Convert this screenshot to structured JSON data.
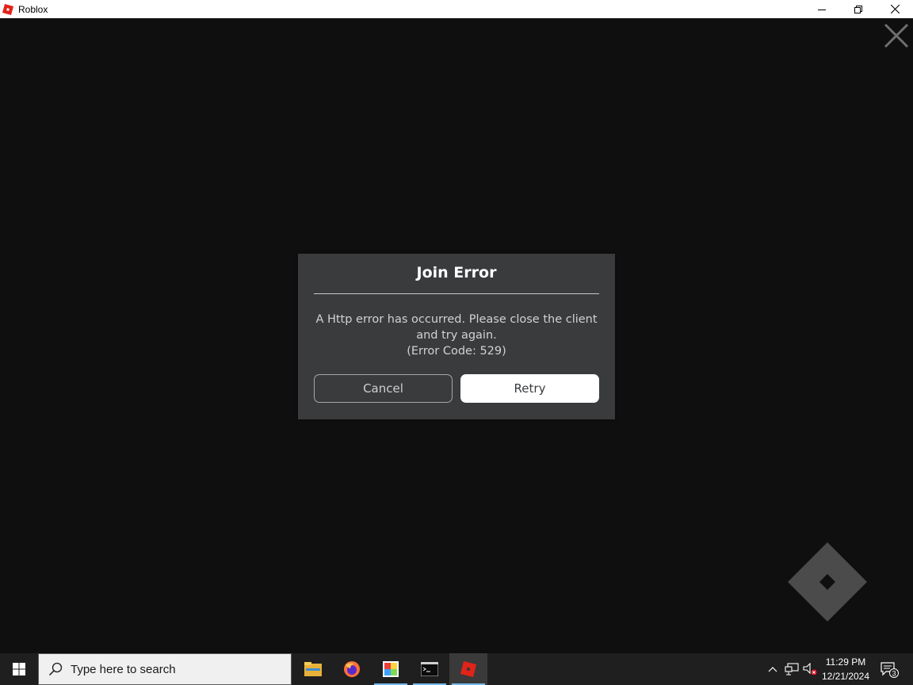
{
  "window": {
    "title": "Roblox",
    "accent": "#e2231a"
  },
  "dialog": {
    "title": "Join Error",
    "message_line1": "A Http error has occurred. Please close the client",
    "message_line2": "and try again.",
    "message_line3": "(Error Code: 529)",
    "cancel_label": "Cancel",
    "retry_label": "Retry",
    "background": "#393b3d"
  },
  "taskbar": {
    "search_placeholder": "Type here to search",
    "apps": [
      "file-explorer-icon",
      "firefox-icon",
      "paint-app-icon",
      "terminal-icon",
      "roblox-icon"
    ],
    "clock_time": "11:29 PM",
    "clock_date": "12/21/2024",
    "notification_count": "3"
  }
}
